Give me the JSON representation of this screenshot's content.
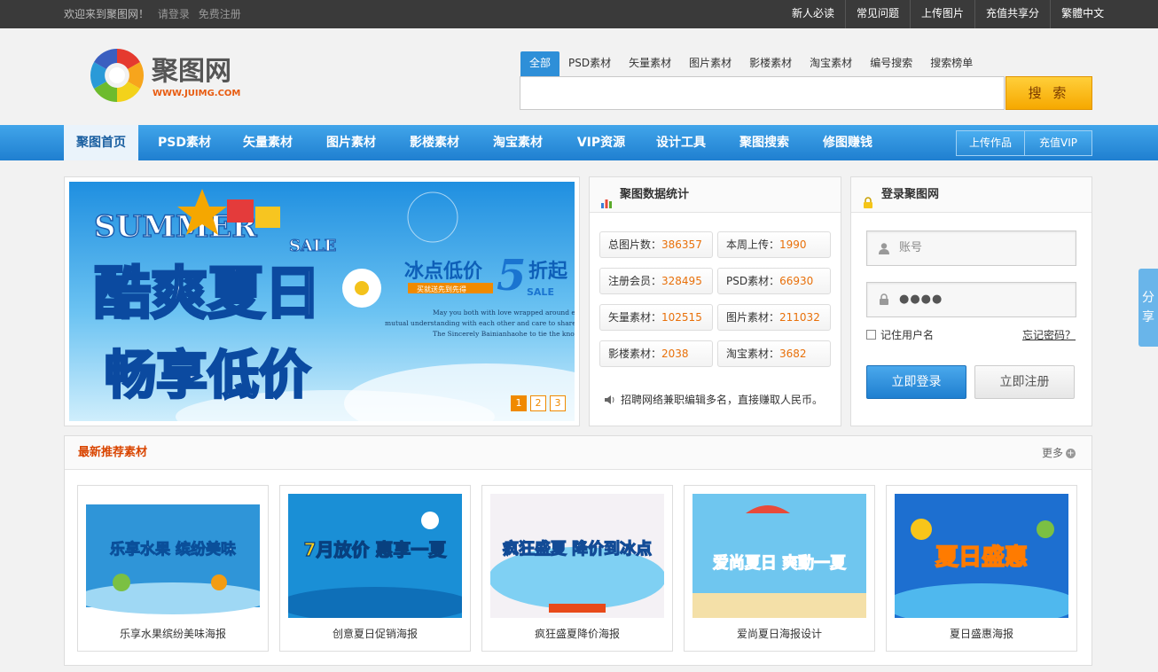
{
  "topbar": {
    "welcome": "欢迎来到聚图网！",
    "login": "请登录",
    "register": "免费注册",
    "links": [
      "新人必读",
      "常见问题",
      "上传图片",
      "充值共享分",
      "繁體中文"
    ]
  },
  "logo": {
    "name": "聚图网",
    "url": "WWW.JUIMG.COM"
  },
  "search": {
    "tabs": [
      "全部",
      "PSD素材",
      "矢量素材",
      "图片素材",
      "影楼素材",
      "淘宝素材",
      "编号搜索",
      "搜索榜单"
    ],
    "active_tab": "全部",
    "button": "搜 索"
  },
  "nav": {
    "items": [
      "聚图首页",
      "PSD素材",
      "矢量素材",
      "图片素材",
      "影楼素材",
      "淘宝素材",
      "VIP资源",
      "设计工具",
      "聚图搜索",
      "修图赚钱"
    ],
    "upload": "上传作品",
    "vip": "充值VIP"
  },
  "banner": {
    "summer": "SUMMER",
    "sale": "SALE",
    "headline_top": "酷爽夏日",
    "headline_bottom": "畅享低价",
    "promo": "冰点低价",
    "promo_num": "5",
    "promo_tail": "折起",
    "promo_sale": "SALE",
    "promo_tag": "买就送先到先得",
    "body_lines": [
      "May you both with love wrapped around each other,",
      "mutual understanding with each other and care to share the future",
      "The Sincerely Bainianhaohe to tie the knot."
    ],
    "pages": [
      "1",
      "2",
      "3"
    ],
    "current_page": "1"
  },
  "stats": {
    "title": "聚图数据统计",
    "items": [
      {
        "label": "总图片数：",
        "value": "386357"
      },
      {
        "label": "本周上传：",
        "value": "1990"
      },
      {
        "label": "注册会员：",
        "value": "328495"
      },
      {
        "label": "PSD素材：",
        "value": "66930"
      },
      {
        "label": "矢量素材：",
        "value": "102515"
      },
      {
        "label": "图片素材：",
        "value": "211032"
      },
      {
        "label": "影楼素材：",
        "value": "2038"
      },
      {
        "label": "淘宝素材：",
        "value": "3682"
      }
    ],
    "notice": "招聘网络兼职编辑多名，直接赚取人民币。"
  },
  "login": {
    "title": "登录聚图网",
    "username_placeholder": "账号",
    "password_value": "●●●●",
    "remember": "记住用户名",
    "forgot": "忘记密码？",
    "login_button": "立即登录",
    "register_button": "立即注册"
  },
  "share": "分享",
  "recommend": {
    "title": "最新推荐素材",
    "more": "更多",
    "items": [
      {
        "caption": "乐享水果缤纷美味海报",
        "art": "乐享水果 缤纷美味"
      },
      {
        "caption": "创意夏日促销海报",
        "art": "7月放价 惠享一夏"
      },
      {
        "caption": "疯狂盛夏降价海报",
        "art": "疯狂盛夏 降价到冰点"
      },
      {
        "caption": "爱尚夏日海报设计",
        "art": "爱尚夏日 爽動一夏"
      },
      {
        "caption": "夏日盛惠海报",
        "art": "夏日盛惠"
      }
    ]
  },
  "colors": {
    "accent_blue": "#2e8fd8",
    "accent_orange": "#e8700a",
    "search_yellow": "#f6a800",
    "topbar_dark": "#3a3a3a"
  }
}
